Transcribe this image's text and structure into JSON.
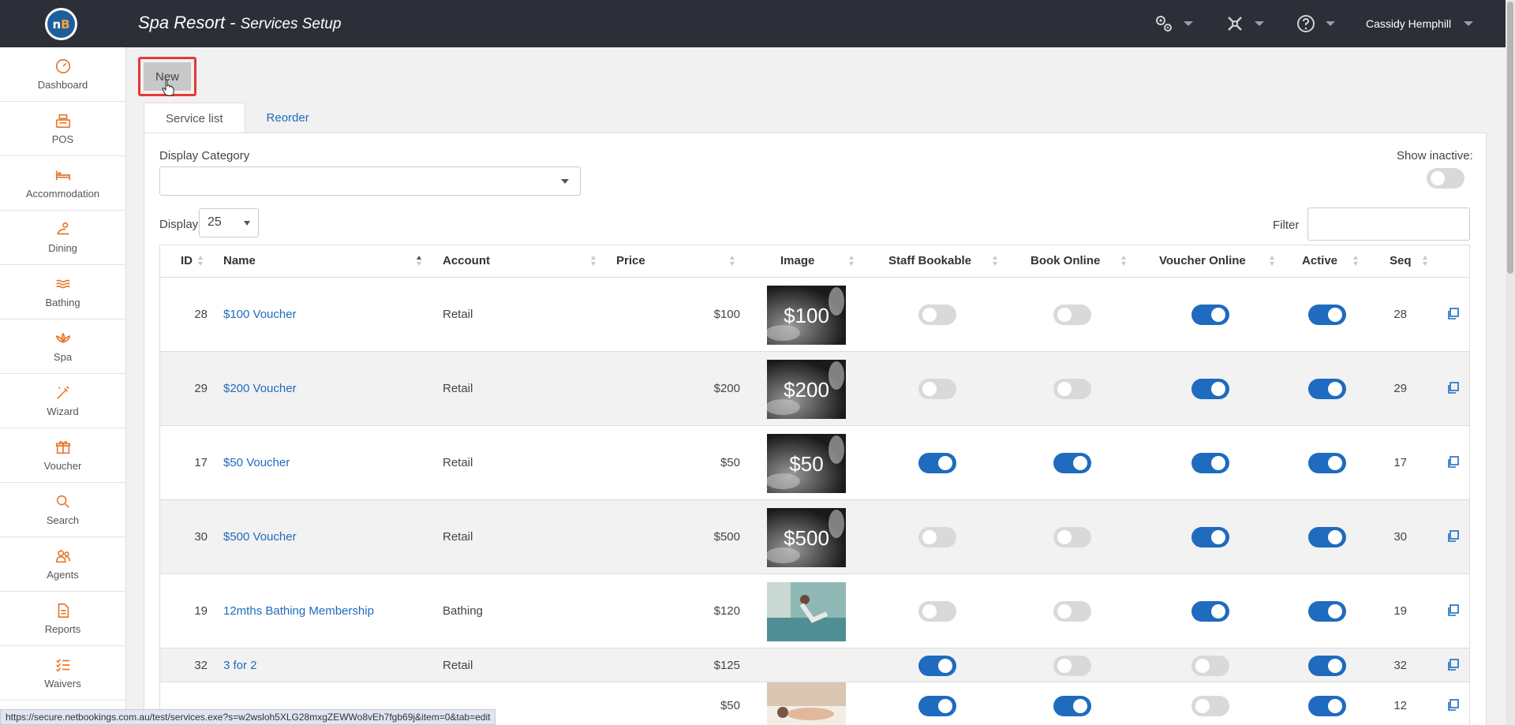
{
  "header": {
    "logo_text": "nB",
    "title_main": "Spa Resort",
    "title_separator": " - ",
    "title_sub": "Services Setup",
    "user_name": "Cassidy Hemphill"
  },
  "sidebar": {
    "items": [
      {
        "label": "Dashboard",
        "icon": "gauge-icon"
      },
      {
        "label": "POS",
        "icon": "cash-register-icon"
      },
      {
        "label": "Accommodation",
        "icon": "bed-icon"
      },
      {
        "label": "Dining",
        "icon": "dining-icon"
      },
      {
        "label": "Bathing",
        "icon": "water-waves-icon"
      },
      {
        "label": "Spa",
        "icon": "lotus-icon"
      },
      {
        "label": "Wizard",
        "icon": "magic-wand-icon"
      },
      {
        "label": "Voucher",
        "icon": "gift-icon"
      },
      {
        "label": "Search",
        "icon": "search-icon"
      },
      {
        "label": "Agents",
        "icon": "agents-icon"
      },
      {
        "label": "Reports",
        "icon": "report-icon"
      },
      {
        "label": "Waivers",
        "icon": "checklist-icon"
      }
    ]
  },
  "toolbar": {
    "new_label": "New"
  },
  "tabs": [
    {
      "label": "Service list",
      "active": true
    },
    {
      "label": "Reorder",
      "active": false
    }
  ],
  "filters": {
    "display_category_label": "Display Category",
    "display_category_value": "",
    "show_inactive_label": "Show inactive:",
    "show_inactive": false,
    "display_label": "Display",
    "display_value": "25",
    "filter_label": "Filter",
    "filter_value": ""
  },
  "table": {
    "columns": [
      "ID",
      "Name",
      "Account",
      "Price",
      "Image",
      "Staff Bookable",
      "Book Online",
      "Voucher Online",
      "Active",
      "Seq"
    ],
    "rows": [
      {
        "id": "28",
        "name": "$100 Voucher",
        "account": "Retail",
        "price": "$100",
        "image": "$100",
        "staff_bookable": false,
        "book_online": false,
        "voucher_online": true,
        "active": true,
        "seq": "28"
      },
      {
        "id": "29",
        "name": "$200 Voucher",
        "account": "Retail",
        "price": "$200",
        "image": "$200",
        "staff_bookable": false,
        "book_online": false,
        "voucher_online": true,
        "active": true,
        "seq": "29"
      },
      {
        "id": "17",
        "name": "$50 Voucher",
        "account": "Retail",
        "price": "$50",
        "image": "$50",
        "staff_bookable": true,
        "book_online": true,
        "voucher_online": true,
        "active": true,
        "seq": "17"
      },
      {
        "id": "30",
        "name": "$500 Voucher",
        "account": "Retail",
        "price": "$500",
        "image": "$500",
        "staff_bookable": false,
        "book_online": false,
        "voucher_online": true,
        "active": true,
        "seq": "30"
      },
      {
        "id": "19",
        "name": "12mths Bathing Membership",
        "account": "Bathing",
        "price": "$120",
        "image": "photo-bathing",
        "staff_bookable": false,
        "book_online": false,
        "voucher_online": true,
        "active": true,
        "seq": "19"
      },
      {
        "id": "32",
        "name": "3 for 2",
        "account": "Retail",
        "price": "$125",
        "image": "",
        "staff_bookable": true,
        "book_online": false,
        "voucher_online": false,
        "active": true,
        "seq": "32"
      },
      {
        "id": "",
        "name": "",
        "account": "",
        "price": "$50",
        "image": "photo-massage",
        "staff_bookable": true,
        "book_online": true,
        "voucher_online": false,
        "active": true,
        "seq": "12"
      }
    ]
  },
  "status_bar": {
    "url": "https://secure.netbookings.com.au/test/services.exe?s=w2wsloh5XLG28mxgZEWWo8vEh7fgb69j&item=0&tab=edit"
  },
  "colors": {
    "accent": "#1e6bbf",
    "sidebar_icon": "#e8762d",
    "topbar": "#2c2f38",
    "highlight": "#e53935"
  }
}
